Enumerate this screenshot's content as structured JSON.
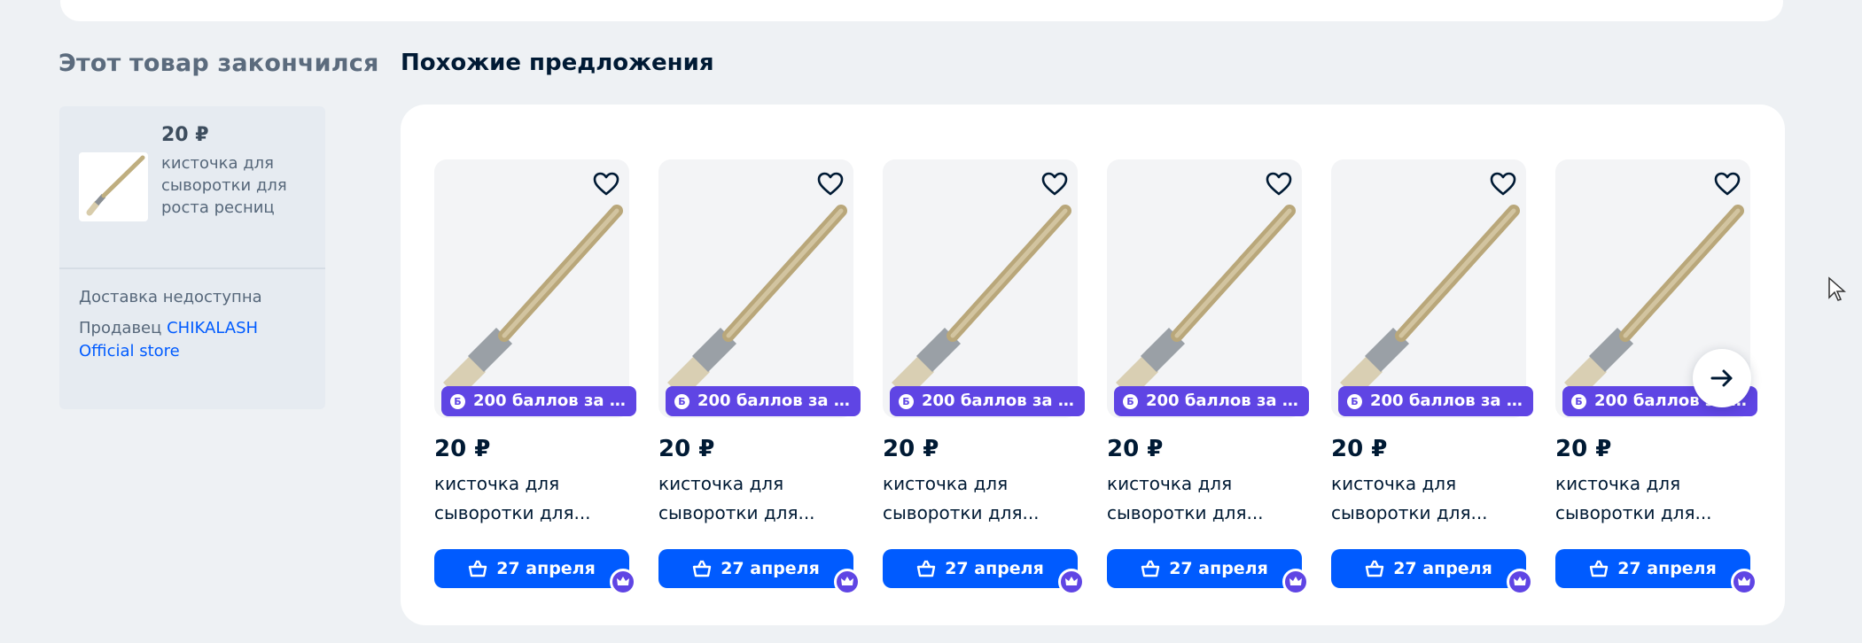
{
  "out_of_stock": {
    "title": "Этот товар закончился",
    "price": "20 ₽",
    "name": "кисточка для сыворотки для роста ресниц",
    "delivery": "Доставка недоступна",
    "seller_label": "Продавец ",
    "seller_name": "CHIKALASH Official store"
  },
  "similar": {
    "title": "Похожие предложения",
    "products": [
      {
        "badge": "200 баллов за о...",
        "price": "20 ₽",
        "name": "кисточка для сыворотки для...",
        "delivery": "27 апреля"
      },
      {
        "badge": "200 баллов за о...",
        "price": "20 ₽",
        "name": "кисточка для сыворотки для...",
        "delivery": "27 апреля"
      },
      {
        "badge": "200 баллов за о...",
        "price": "20 ₽",
        "name": "кисточка для сыворотки для...",
        "delivery": "27 апреля"
      },
      {
        "badge": "200 баллов за о...",
        "price": "20 ₽",
        "name": "кисточка для сыворотки для...",
        "delivery": "27 апреля"
      },
      {
        "badge": "200 баллов за о...",
        "price": "20 ₽",
        "name": "кисточка для сыворотки для...",
        "delivery": "27 апреля"
      },
      {
        "badge": "200 баллов за о...",
        "price": "20 ₽",
        "name": "кисточка для сыворотки для...",
        "delivery": "27 апреля"
      }
    ]
  },
  "badge_icon_letter": "Б",
  "colors": {
    "accent": "#005bff",
    "points": "#5f45e4",
    "background": "#eef1f4"
  }
}
